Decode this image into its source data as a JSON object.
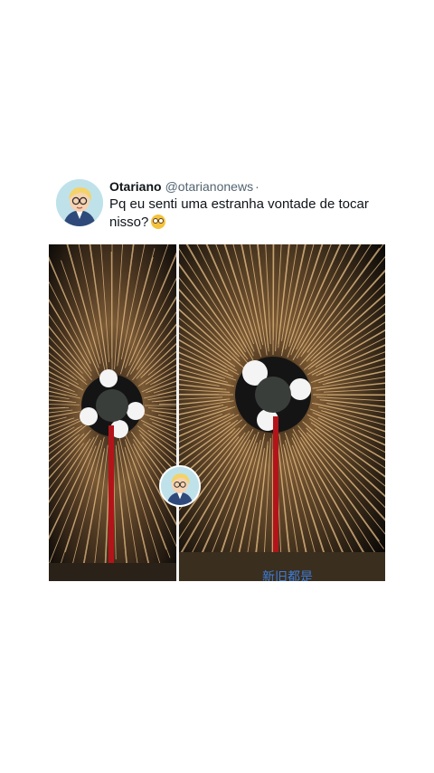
{
  "tweet": {
    "display_name": "Otariano",
    "handle": "@otarianonews",
    "separator": "·",
    "text": "Pq eu senti uma estranha vontade de tocar nisso?",
    "emoji": "flushed-face-emoji"
  },
  "media": {
    "description_icon": "fireworks-video-icon",
    "caption_overlay": "新旧都是"
  },
  "colors": {
    "name": "#0f1419",
    "handle": "#536471",
    "spark": "#e8b878",
    "stream": "#b3141a",
    "background": "#ffffff"
  }
}
